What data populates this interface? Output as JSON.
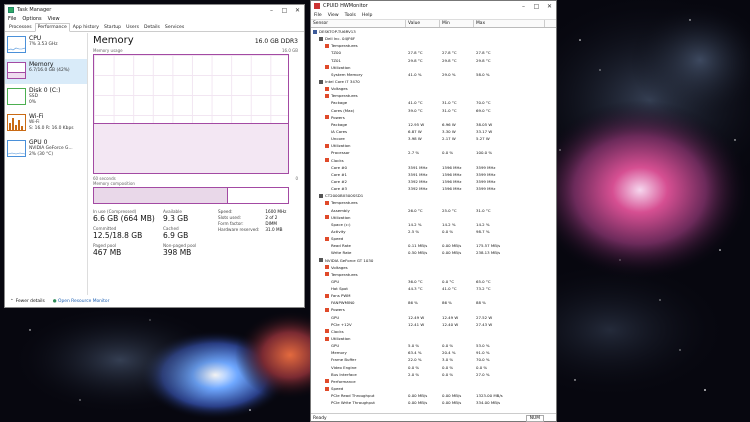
{
  "taskmgr": {
    "title": "Task Manager",
    "menu": [
      "File",
      "Options",
      "View"
    ],
    "tabs": [
      "Processes",
      "Performance",
      "App history",
      "Startup",
      "Users",
      "Details",
      "Services"
    ],
    "active_tab": 1,
    "sidebar": [
      {
        "name": "CPU",
        "sub1": "7% 3.53 GHz",
        "sub2": "",
        "icon": "cpu-spark-icon"
      },
      {
        "name": "Memory",
        "sub1": "6.7/16.0 GB (42%)",
        "sub2": "",
        "icon": "memory-spark-icon",
        "selected": true
      },
      {
        "name": "Disk 0 (C:)",
        "sub1": "SSD",
        "sub2": "0%",
        "icon": "disk-spark-icon"
      },
      {
        "name": "Wi-Fi",
        "sub1": "Wi-Fi",
        "sub2": "S: 16.0  R: 16.0 Kbps",
        "icon": "wifi-spark-icon"
      },
      {
        "name": "GPU 0",
        "sub1": "NVIDIA GeForce G...",
        "sub2": "2% (30 °C)",
        "icon": "gpu-spark-icon"
      }
    ],
    "main": {
      "title": "Memory",
      "capacity": "16.0 GB DDR3",
      "usage_label": "Memory usage",
      "usage_max": "16.0 GB",
      "time_left": "60 seconds",
      "time_right": "0",
      "usage_fraction": 0.42,
      "composition_label": "Memory composition",
      "composition_fraction": 0.69,
      "in_use_label": "In use (Compressed)",
      "in_use_value": "6.6 GB (664 MB)",
      "available_label": "Available",
      "available_value": "9.3 GB",
      "committed_label": "Committed",
      "committed_value": "12.5/18.8 GB",
      "cached_label": "Cached",
      "cached_value": "6.9 GB",
      "paged_label": "Paged pool",
      "paged_value": "467 MB",
      "nonpaged_label": "Non-paged pool",
      "nonpaged_value": "398 MB",
      "details": [
        {
          "k": "Speed:",
          "v": "1600 MHz"
        },
        {
          "k": "Slots used:",
          "v": "2 of 2"
        },
        {
          "k": "Form factor:",
          "v": "DIMM"
        },
        {
          "k": "Hardware reserved:",
          "v": "31.0 MB"
        }
      ]
    },
    "footer": {
      "fewer": "Fewer details",
      "link": "Open Resource Monitor"
    }
  },
  "hwmonitor": {
    "title": "CPUID HWMonitor",
    "menu": [
      "File",
      "View",
      "Tools",
      "Help"
    ],
    "headers": [
      "Sensor",
      "Value",
      "Min",
      "Max"
    ],
    "status_left": "Ready",
    "status_right": "NUM",
    "rows": [
      {
        "l": 0,
        "t": "root",
        "s": "DESKTOP-TU6RV13",
        "v": "",
        "mn": "",
        "mx": ""
      },
      {
        "l": 1,
        "t": "dev",
        "s": "Dell Inc. 04JF6F",
        "v": "",
        "mn": "",
        "mx": ""
      },
      {
        "l": 2,
        "t": "grp",
        "s": "Temperatures",
        "v": "",
        "mn": "",
        "mx": ""
      },
      {
        "l": 3,
        "t": "val",
        "s": "TZ00",
        "v": "27.8 °C",
        "mn": "27.8 °C",
        "mx": "27.8 °C"
      },
      {
        "l": 3,
        "t": "val",
        "s": "TZ01",
        "v": "29.8 °C",
        "mn": "29.8 °C",
        "mx": "29.8 °C"
      },
      {
        "l": 2,
        "t": "grp",
        "s": "Utilization",
        "v": "",
        "mn": "",
        "mx": ""
      },
      {
        "l": 3,
        "t": "val",
        "s": "System Memory",
        "v": "41.0 %",
        "mn": "29.0 %",
        "mx": "58.0 %"
      },
      {
        "l": 1,
        "t": "dev",
        "s": "Intel Core i7 3470",
        "v": "",
        "mn": "",
        "mx": ""
      },
      {
        "l": 2,
        "t": "grp",
        "s": "Voltages",
        "v": "",
        "mn": "",
        "mx": ""
      },
      {
        "l": 2,
        "t": "grp",
        "s": "Temperatures",
        "v": "",
        "mn": "",
        "mx": ""
      },
      {
        "l": 3,
        "t": "val",
        "s": "Package",
        "v": "41.0 °C",
        "mn": "31.0 °C",
        "mx": "70.0 °C"
      },
      {
        "l": 3,
        "t": "val",
        "s": "Cores (Max)",
        "v": "39.0 °C",
        "mn": "31.0 °C",
        "mx": "69.0 °C"
      },
      {
        "l": 2,
        "t": "grp",
        "s": "Powers",
        "v": "",
        "mn": "",
        "mx": ""
      },
      {
        "l": 3,
        "t": "val",
        "s": "Package",
        "v": "12.95 W",
        "mn": "6.96 W",
        "mx": "38.05 W"
      },
      {
        "l": 3,
        "t": "val",
        "s": "IA Cores",
        "v": "6.87 W",
        "mn": "3.30 W",
        "mx": "33.17 W"
      },
      {
        "l": 3,
        "t": "val",
        "s": "Uncore",
        "v": "3.98 W",
        "mn": "2.17 W",
        "mx": "5.27 W"
      },
      {
        "l": 2,
        "t": "grp",
        "s": "Utilization",
        "v": "",
        "mn": "",
        "mx": ""
      },
      {
        "l": 3,
        "t": "val",
        "s": "Processor",
        "v": "2.7 %",
        "mn": "0.0 %",
        "mx": "100.0 %"
      },
      {
        "l": 2,
        "t": "grp",
        "s": "Clocks",
        "v": "",
        "mn": "",
        "mx": ""
      },
      {
        "l": 3,
        "t": "val",
        "s": "Core #0",
        "v": "3591 MHz",
        "mn": "1596 MHz",
        "mx": "3599 MHz"
      },
      {
        "l": 3,
        "t": "val",
        "s": "Core #1",
        "v": "3591 MHz",
        "mn": "1596 MHz",
        "mx": "3599 MHz"
      },
      {
        "l": 3,
        "t": "val",
        "s": "Core #2",
        "v": "3392 MHz",
        "mn": "1596 MHz",
        "mx": "3599 MHz"
      },
      {
        "l": 3,
        "t": "val",
        "s": "Core #3",
        "v": "3392 MHz",
        "mn": "1596 MHz",
        "mx": "3599 MHz"
      },
      {
        "l": 1,
        "t": "dev",
        "s": "CT2000BX500SSD1",
        "v": "",
        "mn": "",
        "mx": ""
      },
      {
        "l": 2,
        "t": "grp",
        "s": "Temperatures",
        "v": "",
        "mn": "",
        "mx": ""
      },
      {
        "l": 3,
        "t": "val",
        "s": "Assembly",
        "v": "26.0 °C",
        "mn": "25.0 °C",
        "mx": "31.0 °C"
      },
      {
        "l": 2,
        "t": "grp",
        "s": "Utilization",
        "v": "",
        "mn": "",
        "mx": ""
      },
      {
        "l": 3,
        "t": "val",
        "s": "Space (c:)",
        "v": "14.2 %",
        "mn": "14.2 %",
        "mx": "14.2 %"
      },
      {
        "l": 3,
        "t": "val",
        "s": "Activity",
        "v": "2.5 %",
        "mn": "0.0 %",
        "mx": "98.7 %"
      },
      {
        "l": 2,
        "t": "grp",
        "s": "Speed",
        "v": "",
        "mn": "",
        "mx": ""
      },
      {
        "l": 3,
        "t": "val",
        "s": "Read Rate",
        "v": "0.11 MB/s",
        "mn": "0.00 MB/s",
        "mx": "175.57 MB/s"
      },
      {
        "l": 3,
        "t": "val",
        "s": "Write Rate",
        "v": "0.50 MB/s",
        "mn": "0.00 MB/s",
        "mx": "238.13 MB/s"
      },
      {
        "l": 1,
        "t": "dev",
        "s": "NVIDIA GeForce GT 1030",
        "v": "",
        "mn": "",
        "mx": ""
      },
      {
        "l": 2,
        "t": "grp",
        "s": "Voltages",
        "v": "",
        "mn": "",
        "mx": ""
      },
      {
        "l": 2,
        "t": "grp",
        "s": "Temperatures",
        "v": "",
        "mn": "",
        "mx": ""
      },
      {
        "l": 3,
        "t": "val",
        "s": "GPU",
        "v": "36.0 °C",
        "mn": "0.0 °C",
        "mx": "65.0 °C"
      },
      {
        "l": 3,
        "t": "val",
        "s": "Hot Spot",
        "v": "44.3 °C",
        "mn": "41.0 °C",
        "mx": "73.2 °C"
      },
      {
        "l": 2,
        "t": "grp",
        "s": "Fans PWM",
        "v": "",
        "mn": "",
        "mx": ""
      },
      {
        "l": 3,
        "t": "val",
        "s": "FANPWMIN0",
        "v": "86 %",
        "mn": "86 %",
        "mx": "88 %"
      },
      {
        "l": 2,
        "t": "grp",
        "s": "Powers",
        "v": "",
        "mn": "",
        "mx": ""
      },
      {
        "l": 3,
        "t": "val",
        "s": "GPU",
        "v": "12.49 W",
        "mn": "12.49 W",
        "mx": "27.52 W"
      },
      {
        "l": 3,
        "t": "val",
        "s": "PCIe +12V",
        "v": "12.41 W",
        "mn": "12.40 W",
        "mx": "27.43 W"
      },
      {
        "l": 2,
        "t": "grp",
        "s": "Clocks",
        "v": "",
        "mn": "",
        "mx": ""
      },
      {
        "l": 2,
        "t": "grp",
        "s": "Utilization",
        "v": "",
        "mn": "",
        "mx": ""
      },
      {
        "l": 3,
        "t": "val",
        "s": "GPU",
        "v": "5.0 %",
        "mn": "0.0 %",
        "mx": "53.0 %"
      },
      {
        "l": 3,
        "t": "val",
        "s": "Memory",
        "v": "63.4 %",
        "mn": "20.4 %",
        "mx": "91.0 %"
      },
      {
        "l": 3,
        "t": "val",
        "s": "Frame Buffer",
        "v": "22.0 %",
        "mn": "3.0 %",
        "mx": "70.0 %"
      },
      {
        "l": 3,
        "t": "val",
        "s": "Video Engine",
        "v": "0.0 %",
        "mn": "0.0 %",
        "mx": "0.0 %"
      },
      {
        "l": 3,
        "t": "val",
        "s": "Bus Interface",
        "v": "2.0 %",
        "mn": "0.0 %",
        "mx": "27.0 %"
      },
      {
        "l": 2,
        "t": "grp",
        "s": "Performance",
        "v": "",
        "mn": "",
        "mx": ""
      },
      {
        "l": 2,
        "t": "grp",
        "s": "Speed",
        "v": "",
        "mn": "",
        "mx": ""
      },
      {
        "l": 3,
        "t": "val",
        "s": "PCIe Read Throughput",
        "v": "0.00 MB/s",
        "mn": "0.00 MB/s",
        "mx": "1323.00 MB/s"
      },
      {
        "l": 3,
        "t": "val",
        "s": "PCIe Write Throughput",
        "v": "0.00 MB/s",
        "mn": "0.00 MB/s",
        "mx": "334.00 MB/s"
      }
    ]
  }
}
